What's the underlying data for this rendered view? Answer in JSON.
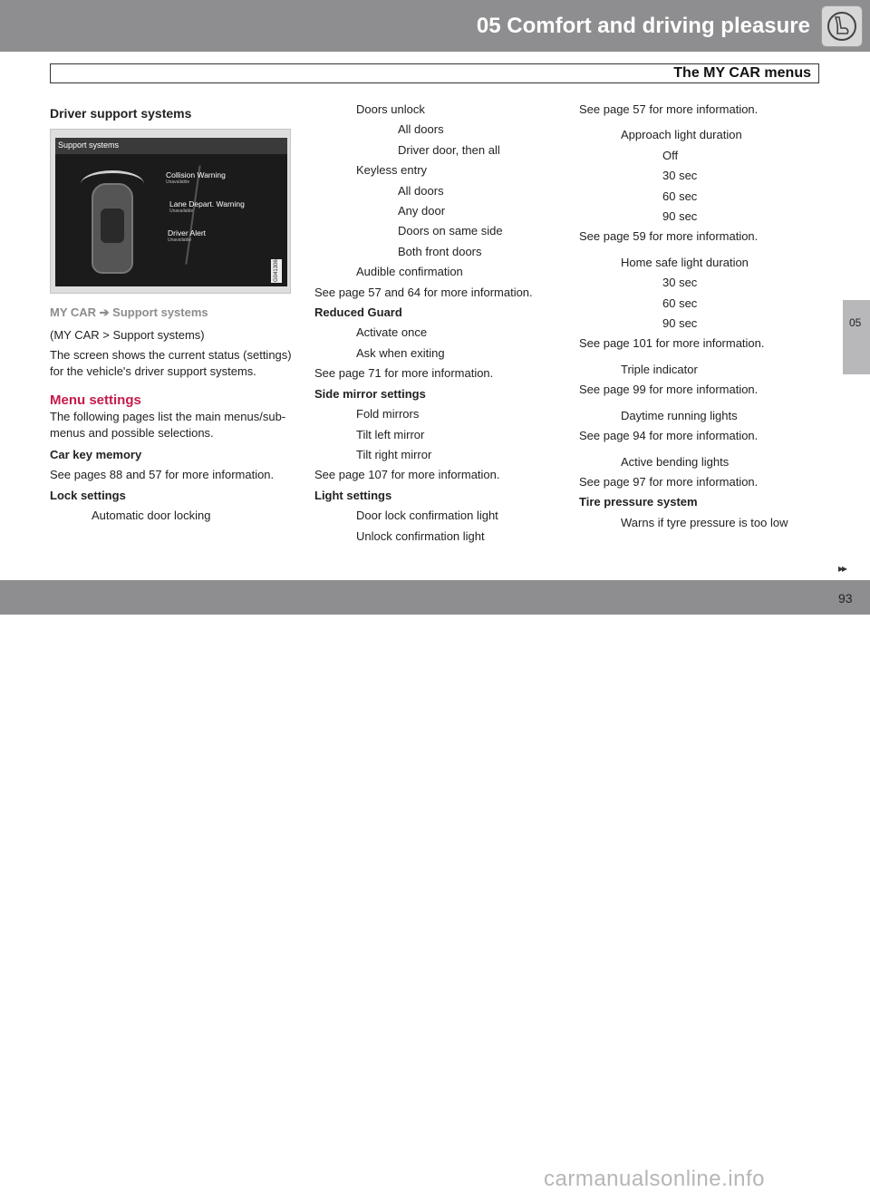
{
  "header": {
    "chapter_title": "05 Comfort and driving pleasure",
    "section_title": "The MY CAR menus",
    "chapter_icon": "seat-icon"
  },
  "side_tab": {
    "label": "05"
  },
  "footer": {
    "page_number": "93",
    "next_arrows": "▸▸",
    "watermark": "carmanualsonline.info"
  },
  "col1": {
    "heading": "Driver support systems",
    "screen": {
      "header": "Support systems",
      "features": [
        {
          "label": "Collision Warning",
          "status": "Unavailable"
        },
        {
          "label": "Lane Depart. Warning",
          "status": "Unavailable"
        },
        {
          "label": "Driver Alert",
          "status": "Unavailable"
        }
      ],
      "code": "G041306"
    },
    "mycar_path": "MY CAR ➔ Support systems",
    "path_paren": "(MY CAR > Support systems)",
    "description": "The screen shows the current status (settings) for the vehicle's driver support systems.",
    "menu_heading": "Menu settings",
    "menu_intro": "The following pages list the main menus/sub-menus and possible selections.",
    "car_key_heading": "Car key memory",
    "car_key_ref": "See pages 88 and 57 for more information.",
    "lock_heading": "Lock settings",
    "auto_lock": "Automatic door locking"
  },
  "col2": {
    "lines": [
      "Doors unlock",
      "All doors",
      "Driver door, then all",
      "Keyless entry",
      "All doors",
      "Any door",
      "Doors on same side",
      "Both front doors",
      "Audible confirmation",
      "See page 57 and 64 for more information.",
      "Reduced Guard",
      "Activate once",
      "Ask when exiting",
      "See page 71 for more information.",
      "Side mirror settings",
      "Fold mirrors",
      "Tilt left mirror",
      "Tilt right mirror",
      "See page 107 for more information.",
      "Light settings",
      "Door lock confirmation light",
      "Unlock confirmation light"
    ]
  },
  "col3": {
    "lines": [
      "See page 57 for more information.",
      "Approach light duration",
      "Off",
      "30 sec",
      "60 sec",
      "90 sec",
      "See page 59 for more information.",
      "Home safe light duration",
      "30 sec",
      "60 sec",
      "90 sec",
      "See page 101 for more information.",
      "Triple indicator",
      "See page 99 for more information.",
      "Daytime running lights",
      "See page 94 for more information.",
      "Active bending lights",
      "See page 97 for more information.",
      "Tire pressure system",
      "Warns if tyre pressure is too low"
    ]
  }
}
